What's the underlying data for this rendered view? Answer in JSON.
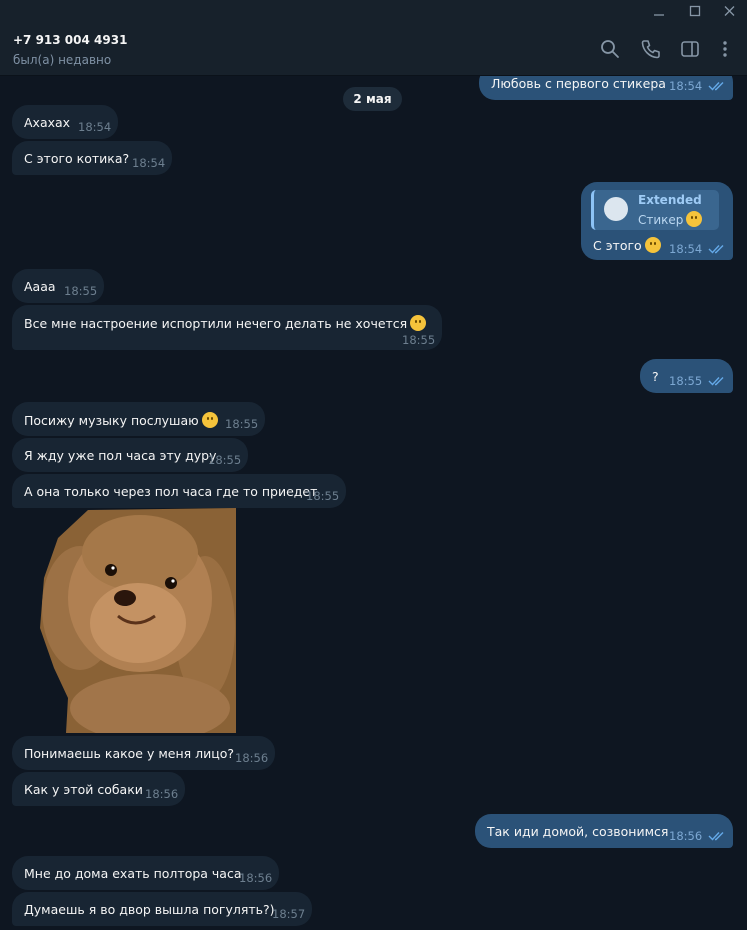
{
  "window": {
    "controls": [
      "minimize-icon",
      "maximize-icon",
      "close-icon"
    ]
  },
  "header": {
    "contact_name": "+7 913 004 4931",
    "status": "был(а) недавно",
    "icons": [
      "search-icon",
      "phone-icon",
      "sidebar-toggle-icon",
      "more-vert-icon"
    ]
  },
  "chat": {
    "date_separator": "2 мая",
    "messages": [
      {
        "dir": "out",
        "text": "Любовь с первого стикера",
        "time": "18:54",
        "read": true
      },
      {
        "dir": "in",
        "text": "Ахахах",
        "time": "18:54"
      },
      {
        "dir": "in",
        "text": "С этого котика?",
        "time": "18:54"
      },
      {
        "dir": "out",
        "text": "С этого",
        "time": "18:54",
        "read": true,
        "reply": {
          "title": "Extended",
          "subtitle": "Стикер"
        }
      },
      {
        "dir": "in",
        "text": "Аааа",
        "time": "18:55"
      },
      {
        "dir": "in",
        "text": "Все мне настроение испортили нечего делать не хочется",
        "time": "18:55"
      },
      {
        "dir": "out",
        "text": "?",
        "time": "18:55",
        "read": true
      },
      {
        "dir": "in",
        "text": "Посижу музыку послушаю",
        "time": "18:55"
      },
      {
        "dir": "in",
        "text": "Я жду уже пол часа эту дуру",
        "time": "18:55"
      },
      {
        "dir": "in",
        "text": "А она только через пол часа где то приедет",
        "time": "18:55"
      },
      {
        "dir": "in",
        "type": "sticker",
        "sticker": "poodle-dog-sticker"
      },
      {
        "dir": "in",
        "text": "Понимаешь какое у меня лицо?",
        "time": "18:56"
      },
      {
        "dir": "in",
        "text": "Как у этой собаки",
        "time": "18:56"
      },
      {
        "dir": "out",
        "text": "Так иди домой, созвонимся",
        "time": "18:56",
        "read": true
      },
      {
        "dir": "in",
        "text": "Мне до дома ехать полтора часа",
        "time": "18:56"
      },
      {
        "dir": "in",
        "text": "Думаешь я во двор вышла погулять?)",
        "time": "18:57"
      }
    ]
  },
  "colors": {
    "background": "#0e1621",
    "header": "#17212b",
    "incoming_bubble": "#182533",
    "outgoing_bubble": "#2b5278",
    "read_ticks": "#64a9e8"
  }
}
